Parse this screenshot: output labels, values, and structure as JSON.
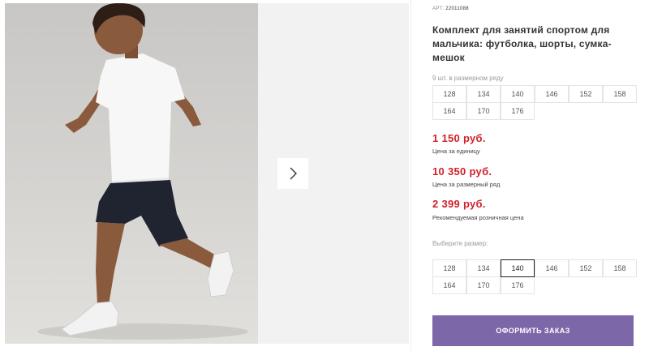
{
  "product": {
    "art_prefix": "АРТ:",
    "art_number": "22011088",
    "title": "Комплект для занятий спортом для мальчика: футболка, шорты, сумка-мешок",
    "row_note": "9 шт. в размерном ряду",
    "row_sizes": [
      "128",
      "134",
      "140",
      "146",
      "152",
      "158",
      "164",
      "170",
      "176"
    ]
  },
  "prices": {
    "unit_price": "1 150 руб.",
    "unit_label": "Цена за единицу",
    "row_price": "10 350 руб.",
    "row_label": "Цена за размерный ряд",
    "retail_price": "2 399 руб.",
    "retail_label": "Рекомендуемая розничная цена"
  },
  "size_select": {
    "label": "Выберите размер:",
    "sizes": [
      "128",
      "134",
      "140",
      "146",
      "152",
      "158",
      "164",
      "170",
      "176"
    ],
    "selected": "140"
  },
  "order_button": {
    "label": "ОФОРМИТЬ ЗАКАЗ"
  },
  "colors": {
    "price_red": "#d11f2a",
    "button_purple": "#7c68a8"
  },
  "icons": {
    "gallery_next": "chevron-right-icon"
  }
}
